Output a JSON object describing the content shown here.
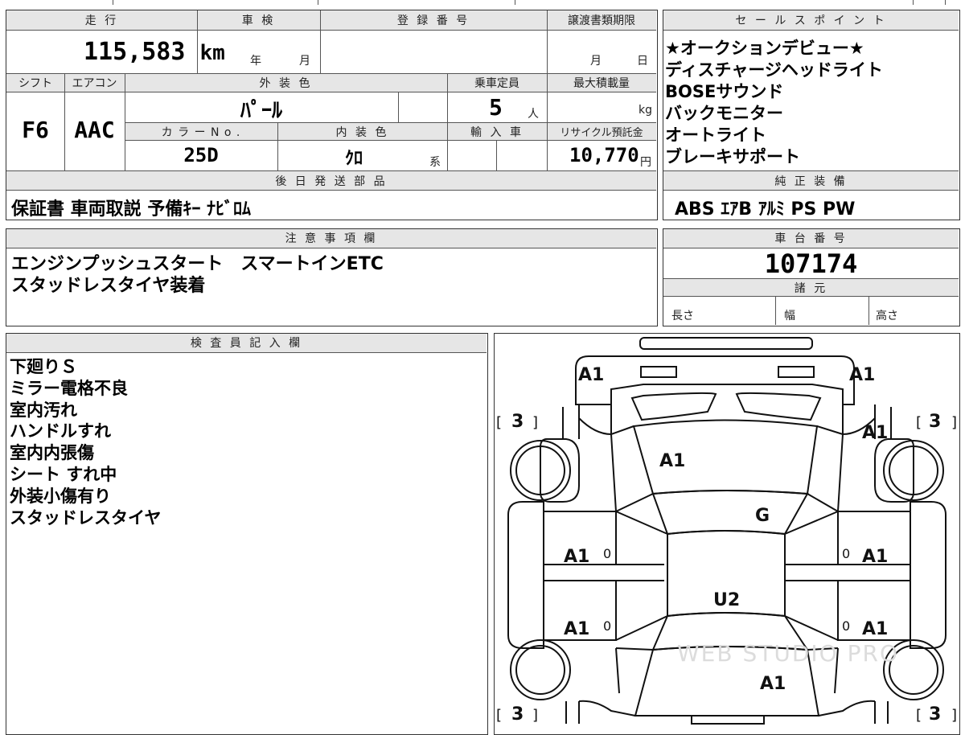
{
  "main": {
    "mileage_label": "走 行",
    "mileage_value": "115,583",
    "mileage_unit": "km",
    "shaken_label": "車 検",
    "shaken_year": "年",
    "shaken_month": "月",
    "reg_label": "登 録 番 号",
    "transfer_label": "譲渡書類期限",
    "transfer_month": "月",
    "transfer_day": "日",
    "shift_label": "シフト",
    "shift_value": "F6",
    "ac_label": "エアコン",
    "ac_value": "AAC",
    "exterior_label": "外 装 色",
    "exterior_value": "ﾊﾟｰﾙ",
    "capacity_label": "乗車定員",
    "capacity_value": "5",
    "capacity_unit": "人",
    "load_label": "最大積載量",
    "load_unit": "kg",
    "color_no_label": "カ ラ ー N o .",
    "color_no_value": "25D",
    "interior_label": "内 装 色",
    "interior_value": "ｸﾛ",
    "interior_suffix": "系",
    "import_label": "輸 入 車",
    "recycle_label": "リサイクル預託金",
    "recycle_value": "10,770",
    "recycle_unit": "円",
    "later_label": "後 日 発 送 部 品",
    "later_value": "保証書 車両取説 予備ｷｰ ﾅﾋﾞﾛﾑ"
  },
  "sales": {
    "title": "セ ー ル ス ポ イ ン ト",
    "items": [
      "★オークションデビュー★",
      "ディスチャージヘッドライト",
      "BOSEサウンド",
      "バックモニター",
      "オートライト",
      "ブレーキサポート"
    ]
  },
  "equipment": {
    "title": "純 正 装 備",
    "value": "ABS ｴｱB ｱﾙﾐ PS PW"
  },
  "notes": {
    "title": "注 意 事 項 欄",
    "lines": [
      "エンジンプッシュスタート　スマートインETC",
      "スタッドレスタイヤ装着"
    ]
  },
  "chassis": {
    "title": "車 台 番 号",
    "value": "107174",
    "spec_title": "諸 元",
    "length_label": "長さ",
    "width_label": "幅",
    "height_label": "高さ"
  },
  "inspector": {
    "title": "検 査 員 記 入 欄",
    "lines": [
      "下廻りＳ",
      "ミラー電格不良",
      "室内汚れ",
      "ハンドルすれ",
      "室内内張傷",
      "シート すれ中",
      "外装小傷有り",
      "スタッドレスタイヤ"
    ]
  },
  "diagram": {
    "front_left": "A1",
    "front_right": "A1",
    "tire_fl": "3",
    "tire_fr": "3",
    "tire_rl": "3",
    "tire_rr": "3",
    "fender_fr": "A1",
    "hood": "A1",
    "windshield": "G",
    "door_fl": "A1",
    "door_fr": "A1",
    "door_rl": "A1",
    "door_rr": "A1",
    "mark_fl": "0",
    "mark_fr": "0",
    "mark_rl": "0",
    "mark_rr": "0",
    "roof": "U2",
    "trunk": "A1",
    "watermark": "WEB STUDIO PRO"
  }
}
